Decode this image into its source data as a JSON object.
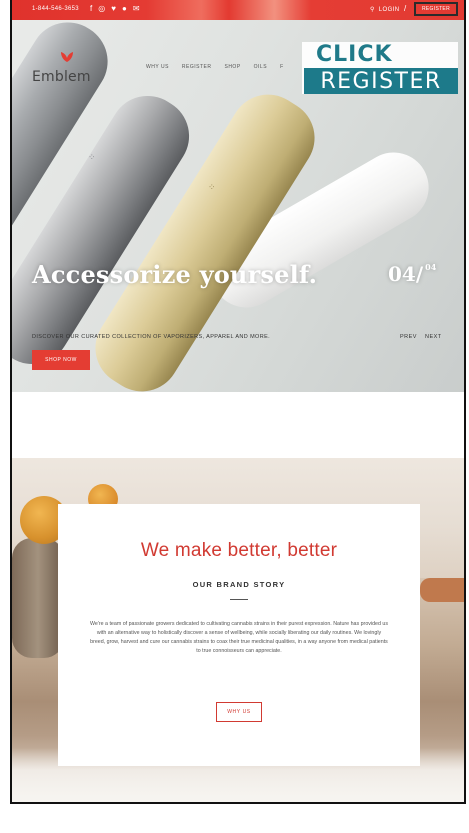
{
  "topbar": {
    "phone": "1-844-546-3653",
    "social_icons": [
      "f",
      "◎",
      "♥",
      "●",
      "✉"
    ],
    "login_label": "LOGIN",
    "separator": "/",
    "register_label": "REGISTER"
  },
  "brand": {
    "name": "Emblem",
    "accent": "#e43d33"
  },
  "menu": [
    "WHY US",
    "REGISTER",
    "SHOP",
    "OILS",
    "F"
  ],
  "overlay": {
    "click_text": "CLICK",
    "register_text": "REGISTER",
    "color": "#1d7a8a"
  },
  "hero": {
    "headline": "Accessorize yourself.",
    "slide_current": "04/",
    "slide_total": "04",
    "tagline": "DISCOVER OUR CURATED COLLECTION OF VAPORIZERS, APPAREL AND MORE.",
    "prev_label": "PREV",
    "next_label": "NEXT",
    "shop_label": "SHOP NOW"
  },
  "story": {
    "title": "We make better, better",
    "subtitle": "OUR BRAND STORY",
    "body": "We're a team of passionate growers dedicated to cultivating cannabis strains in their purest expression. Nature has provided us with an alternative way to holistically discover a sense of wellbeing, while socially liberating our daily routines. We lovingly breed, grow, harvest and cure our cannabis strains to coax their true medicinal qualities, in a way anyone from medical patients to true connoisseurs can appreciate.",
    "button_label": "WHY US"
  }
}
